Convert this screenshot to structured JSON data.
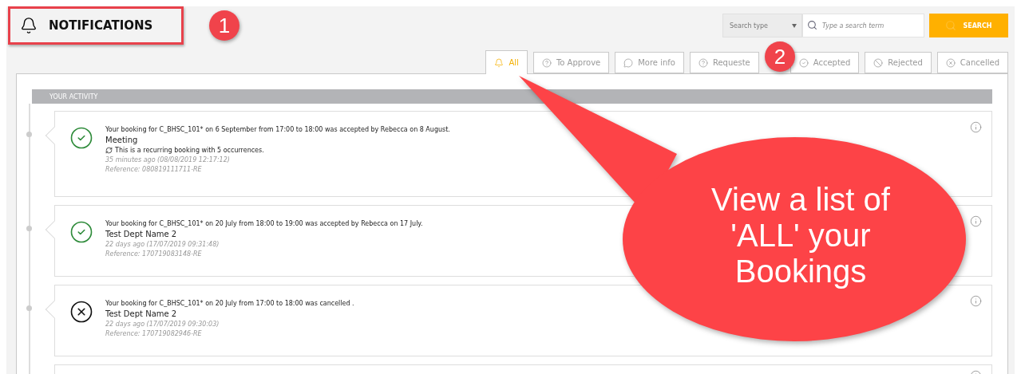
{
  "header": {
    "title": "NOTIFICATIONS",
    "highlighted": true
  },
  "search": {
    "type_placeholder": "Search type",
    "placeholder": "Type a search term",
    "button": "SEARCH"
  },
  "tabs": [
    {
      "label": "All",
      "kind": "all",
      "selected": true
    },
    {
      "label": "To Approve",
      "kind": "approve",
      "selected": false
    },
    {
      "label": "More info",
      "kind": "info",
      "selected": false
    },
    {
      "label": "Requeste",
      "kind": "request",
      "selected": false
    },
    {
      "label": "Accepted",
      "kind": "accepted",
      "selected": false
    },
    {
      "label": "Rejected",
      "kind": "rejected",
      "selected": false
    },
    {
      "label": "Cancelled",
      "kind": "cancelled",
      "selected": false
    }
  ],
  "activity": {
    "heading": "YOUR ACTIVITY",
    "items": [
      {
        "kind": "accepted",
        "message": "Your booking for C_BHSC_101* on 6 September from 17:00 to 18:00 was accepted by Rebecca on 8 August.",
        "title": "Meeting",
        "recurring": "This is a recurring booking with 5 occurrences.",
        "time": "35 minutes ago (08/08/2019 12:17:12)",
        "reference": "Reference: 080819111711-RE"
      },
      {
        "kind": "accepted",
        "message": "Your booking for C_BHSC_101* on 20 July from 18:00 to 19:00 was accepted by Rebecca on 17 July.",
        "title": "Test Dept Name 2",
        "time": "22 days ago (17/07/2019 09:31:48)",
        "reference": "Reference: 170719083148-RE"
      },
      {
        "kind": "cancelled",
        "message": "Your booking for C_BHSC_101* on 20 July from 17:00 to 18:00 was cancelled .",
        "title": "Test Dept Name 2",
        "time": "22 days ago (17/07/2019 09:30:03)",
        "reference": "Reference: 170719082946-RE"
      },
      {
        "kind": "cut_off"
      }
    ]
  },
  "badges": [
    "1",
    "2"
  ],
  "callout": {
    "text": "View a list of 'ALL' your Bookings"
  }
}
